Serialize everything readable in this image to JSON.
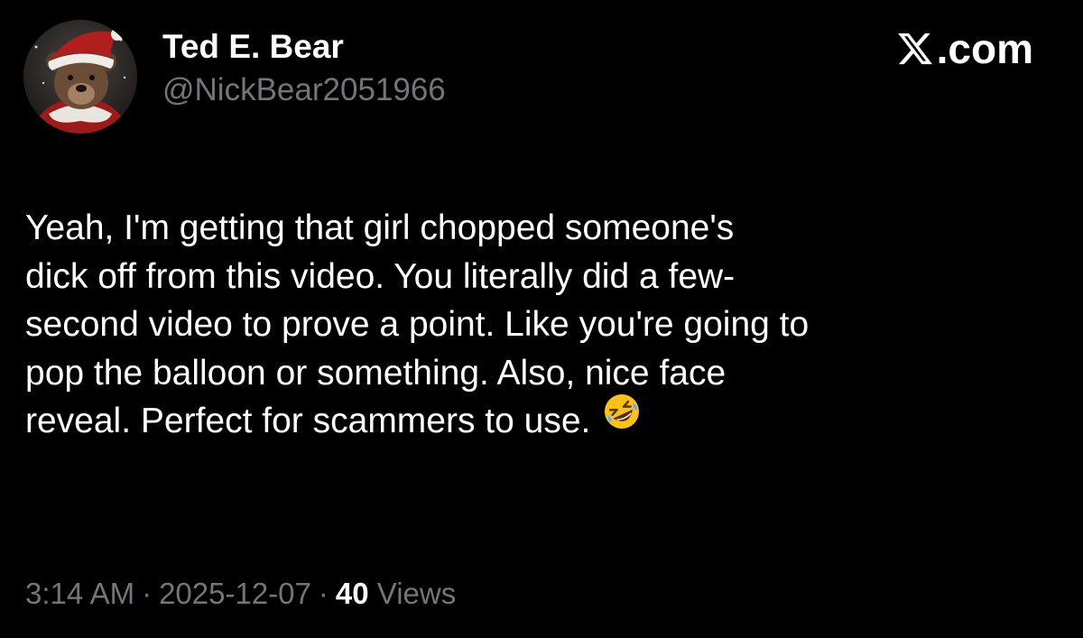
{
  "author": {
    "display_name": "Ted E. Bear",
    "handle": "@NickBear2051966",
    "avatar_icon": "bear-in-santa-hat-avatar"
  },
  "brand": {
    "label": ".com",
    "icon": "x-logo-icon"
  },
  "post": {
    "lines": [
      "Yeah, I'm getting that girl chopped someone's",
      "dick off from this video. You literally did a few-",
      "second video to prove a point. Like you're going to",
      "pop the balloon or something. Also, nice face",
      "reveal. Perfect for scammers to use."
    ],
    "emoji": "rolling-on-floor-laughing-emoji"
  },
  "meta": {
    "time": "3:14 AM",
    "separator": "·",
    "date": "2025-12-07",
    "views_count": "40",
    "views_label": "Views"
  },
  "colors": {
    "background": "#000000",
    "primary_text": "#ffffff",
    "secondary_text": "#71767b"
  }
}
